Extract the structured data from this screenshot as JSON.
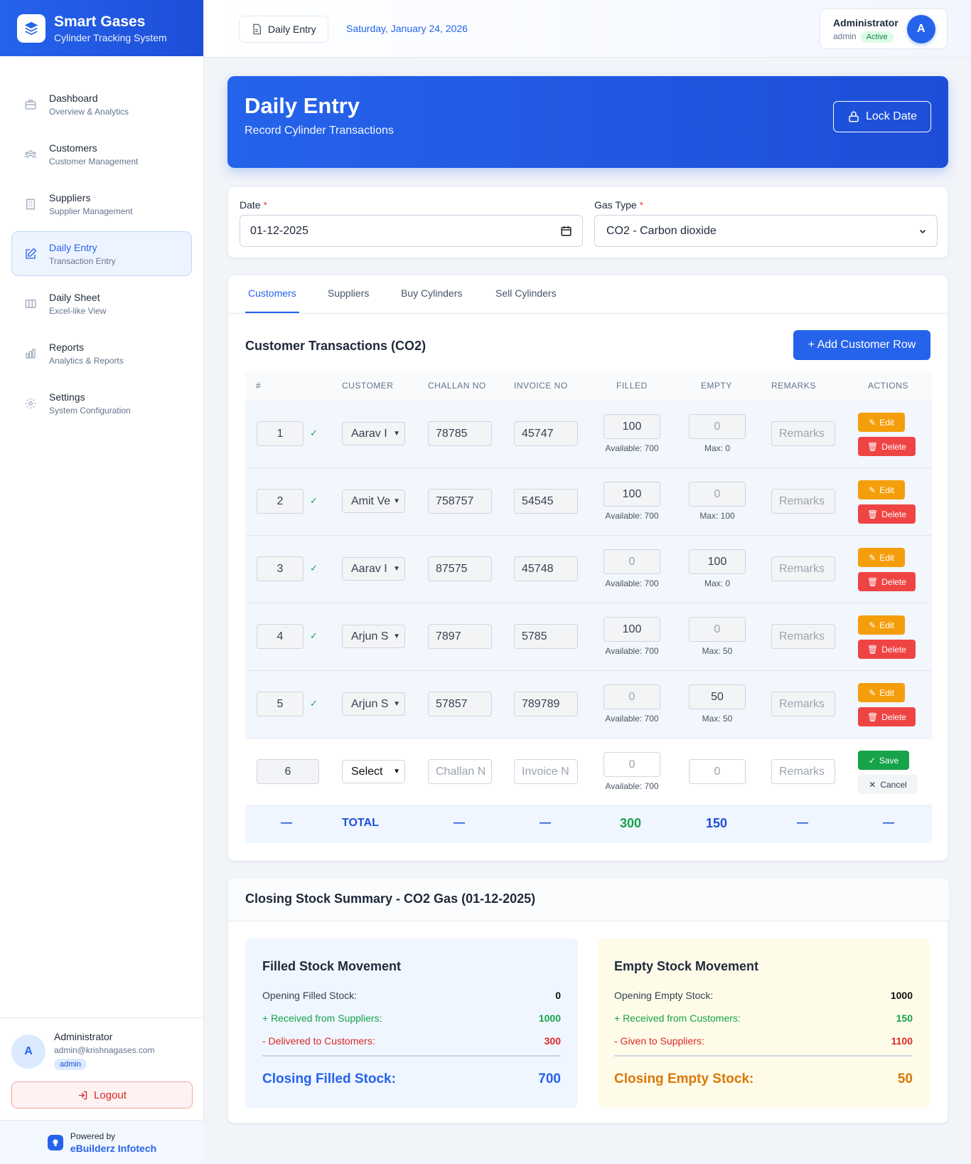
{
  "brand": {
    "title": "Smart Gases",
    "subtitle": "Cylinder Tracking System"
  },
  "nav": [
    {
      "label": "Dashboard",
      "sub": "Overview & Analytics",
      "icon": "briefcase-icon"
    },
    {
      "label": "Customers",
      "sub": "Customer Management",
      "icon": "users-icon"
    },
    {
      "label": "Suppliers",
      "sub": "Supplier Management",
      "icon": "building-icon"
    },
    {
      "label": "Daily Entry",
      "sub": "Transaction Entry",
      "icon": "edit-icon"
    },
    {
      "label": "Daily Sheet",
      "sub": "Excel-like View",
      "icon": "columns-icon"
    },
    {
      "label": "Reports",
      "sub": "Analytics & Reports",
      "icon": "bar-chart-icon"
    },
    {
      "label": "Settings",
      "sub": "System Configuration",
      "icon": "gear-icon"
    }
  ],
  "side_user": {
    "initial": "A",
    "name": "Administrator",
    "email": "admin@krishnagases.com",
    "role": "admin",
    "logout": "Logout"
  },
  "powered": {
    "line1": "Powered by",
    "line2": "eBuilderz Infotech"
  },
  "header": {
    "crumb": "Daily Entry",
    "date": "Saturday, January 24, 2026",
    "user": "Administrator",
    "role": "admin",
    "status": "Active",
    "initial": "A"
  },
  "hero": {
    "title": "Daily Entry",
    "subtitle": "Record Cylinder Transactions",
    "lock": "Lock Date"
  },
  "form": {
    "date_label": "Date",
    "date_value": "01-12-2025",
    "gas_label": "Gas Type",
    "gas_value": "CO2 - Carbon dioxide",
    "req": "*"
  },
  "tabs": [
    "Customers",
    "Suppliers",
    "Buy Cylinders",
    "Sell Cylinders"
  ],
  "section": {
    "title": "Customer Transactions (CO2)",
    "add": "+ Add Customer Row"
  },
  "columns": [
    "#",
    "Customer",
    "Challan No",
    "Invoice No",
    "Filled",
    "Empty",
    "Remarks",
    "Actions"
  ],
  "rows": [
    {
      "no": "1",
      "customer": "Aarav I",
      "challan": "78785",
      "invoice": "45747",
      "filled": "100",
      "empty": "0",
      "avail": "Available: 700",
      "max": "Max: 0",
      "remarks": "Remarks"
    },
    {
      "no": "2",
      "customer": "Amit Ve",
      "challan": "758757",
      "invoice": "54545",
      "filled": "100",
      "empty": "0",
      "avail": "Available: 700",
      "max": "Max: 100",
      "remarks": "Remarks"
    },
    {
      "no": "3",
      "customer": "Aarav I",
      "challan": "87575",
      "invoice": "45748",
      "filled": "0",
      "empty": "100",
      "avail": "Available: 700",
      "max": "Max: 0",
      "remarks": "Remarks"
    },
    {
      "no": "4",
      "customer": "Arjun S",
      "challan": "7897",
      "invoice": "5785",
      "filled": "100",
      "empty": "0",
      "avail": "Available: 700",
      "max": "Max: 50",
      "remarks": "Remarks"
    },
    {
      "no": "5",
      "customer": "Arjun S",
      "challan": "57857",
      "invoice": "789789",
      "filled": "0",
      "empty": "50",
      "avail": "Available: 700",
      "max": "Max: 50",
      "remarks": "Remarks"
    }
  ],
  "actions": {
    "edit": "Edit",
    "delete": "Delete",
    "save": "Save",
    "cancel": "Cancel",
    "check": "✓"
  },
  "new_row": {
    "no": "6",
    "customer": "Select",
    "challan_ph": "Challan N",
    "invoice_ph": "Invoice N",
    "filled": "0",
    "empty": "0",
    "avail": "Available: 700",
    "remarks_ph": "Remarks"
  },
  "totals": {
    "dash": "—",
    "label": "TOTAL",
    "filled": "300",
    "empty": "150"
  },
  "summary": {
    "title": "Closing Stock Summary - CO2 Gas (01-12-2025)",
    "filled": {
      "title": "Filled Stock Movement",
      "open_label": "Opening Filled Stock:",
      "open": "0",
      "recv_label": "+ Received from Suppliers:",
      "recv": "1000",
      "deliv_label": "- Delivered to Customers:",
      "deliv": "300",
      "close_label": "Closing Filled Stock:",
      "close": "700"
    },
    "empty": {
      "title": "Empty Stock Movement",
      "open_label": "Opening Empty Stock:",
      "open": "1000",
      "recv_label": "+ Received from Customers:",
      "recv": "150",
      "given_label": "- Given to Suppliers:",
      "given": "1100",
      "close_label": "Closing Empty Stock:",
      "close": "50"
    }
  },
  "colors": {
    "primary": "#2563eb",
    "green": "#16a34a",
    "red": "#dc2626",
    "amber": "#d97706"
  }
}
